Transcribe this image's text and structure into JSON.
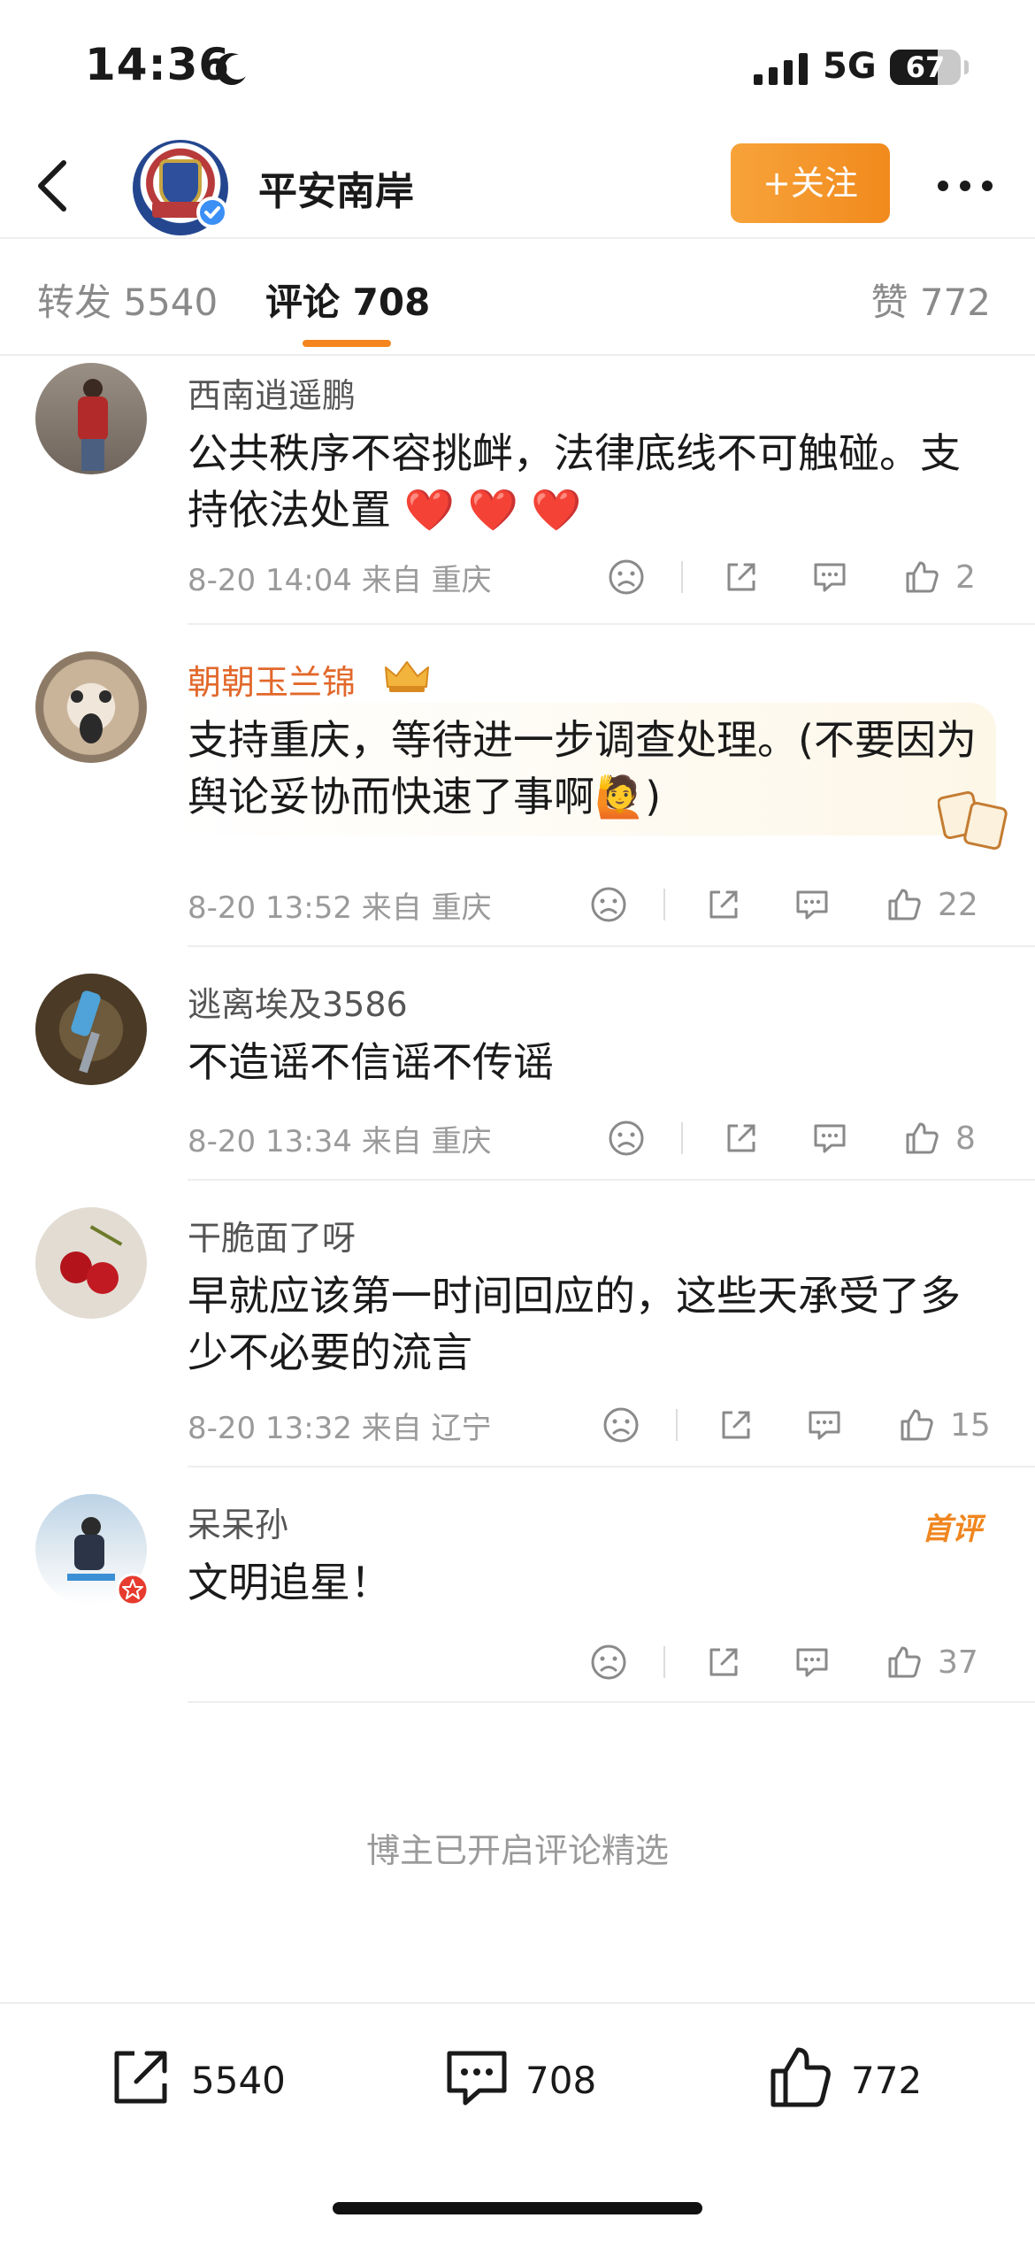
{
  "status_bar": {
    "time": "14:36",
    "network": "5G",
    "battery": "67",
    "battery_level": 0.67
  },
  "header": {
    "account_name": "平安南岸",
    "follow_label": "+关注"
  },
  "tabs": {
    "reposts": "转发 5540",
    "comments": "评论 708",
    "likes": "赞 772"
  },
  "comments": [
    {
      "name": "西南逍遥鹏",
      "text": "公共秩序不容挑衅，法律底线不可触碰。支持依法处置 ❤️ ❤️ ❤️",
      "meta": "8-20 14:04  来自 重庆",
      "likes": "2"
    },
    {
      "name": "朝朝玉兰锦",
      "text": "支持重庆，等待进一步调查处理。(不要因为舆论妥协而快速了事啊🙋)",
      "meta": "8-20 13:52  来自 重庆",
      "likes": "22"
    },
    {
      "name": "逃离埃及3586",
      "text": "不造谣不信谣不传谣",
      "meta": "8-20 13:34  来自 重庆",
      "likes": "8"
    },
    {
      "name": "干脆面了呀",
      "text": "早就应该第一时间回应的，这些天承受了多少不必要的流言",
      "meta": "8-20 13:32  来自 辽宁",
      "likes": "15"
    },
    {
      "name": "呆呆孙",
      "text": "文明追星！",
      "meta": "",
      "likes": "37",
      "tag": "首评"
    }
  ],
  "curated_note": "博主已开启评论精选",
  "bottom_bar": {
    "reposts": "5540",
    "comments": "708",
    "likes": "772"
  },
  "colors": {
    "accent": "#f18a1d",
    "vip_name": "#e2682b",
    "verify": "#3b8ff5"
  }
}
